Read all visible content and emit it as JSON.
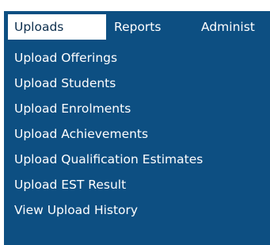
{
  "menubar": {
    "items": [
      {
        "label": "Uploads",
        "active": true
      },
      {
        "label": "Reports",
        "active": false
      },
      {
        "label": "Administ",
        "active": false
      }
    ]
  },
  "dropdown": {
    "items": [
      {
        "label": "Upload Offerings"
      },
      {
        "label": "Upload Students"
      },
      {
        "label": "Upload Enrolments"
      },
      {
        "label": "Upload Achievements"
      },
      {
        "label": "Upload Qualification Estimates"
      },
      {
        "label": "Upload EST Result"
      },
      {
        "label": "View Upload History"
      }
    ]
  },
  "colors": {
    "menu_background": "#0d4f82",
    "active_tab_background": "#ffffff",
    "active_tab_text": "#0c2e4d",
    "text": "#ffffff"
  }
}
